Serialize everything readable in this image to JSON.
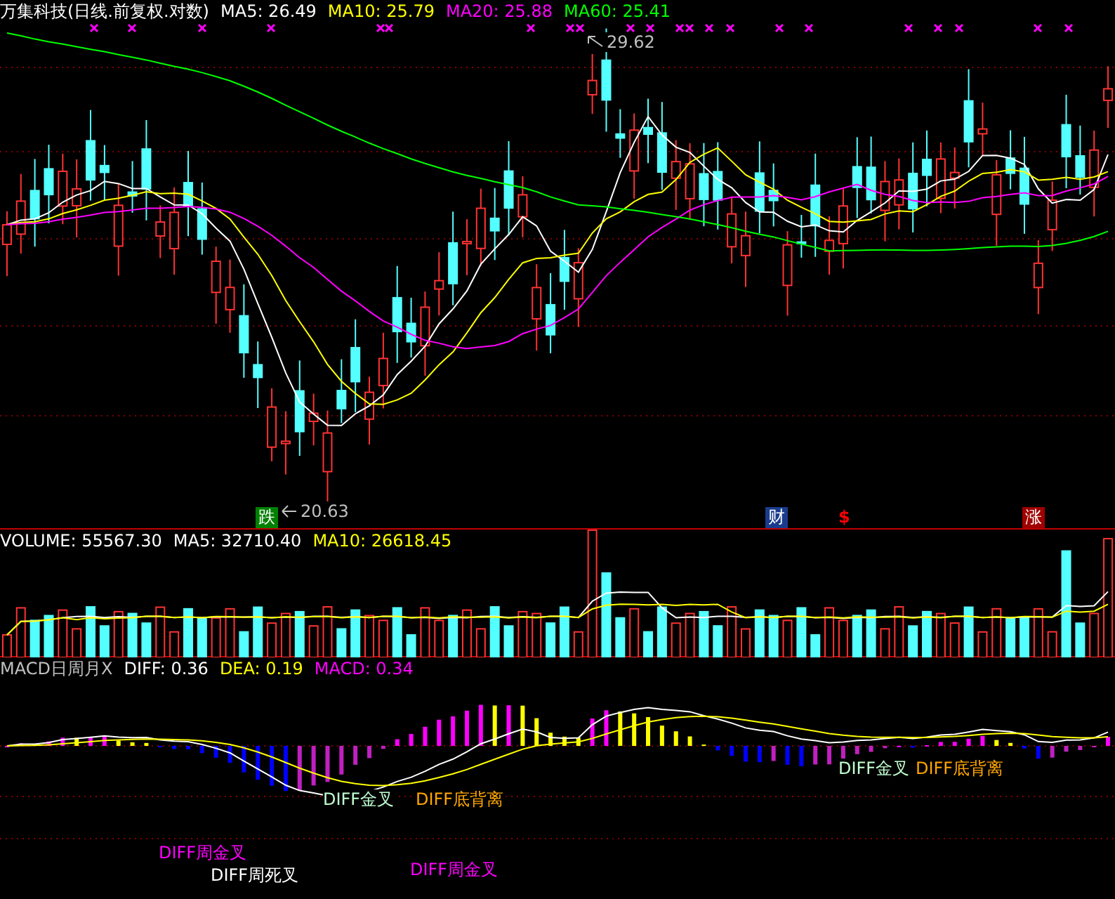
{
  "price_panel": {
    "title": "万集科技(日线.前复权.对数)",
    "ma_readings": [
      {
        "text": "MA5: 26.49",
        "color": "#ffffff"
      },
      {
        "text": "MA10: 25.79",
        "color": "#ffff00"
      },
      {
        "text": "MA20: 25.88",
        "color": "#ff00ff"
      },
      {
        "text": "MA60: 25.41",
        "color": "#00ff00"
      }
    ],
    "high_label": "29.62",
    "low_label": "20.63",
    "markers": [
      {
        "text": "跌",
        "kind": "badge",
        "color": "#008000"
      },
      {
        "text": "财",
        "kind": "badge",
        "color": "#1a3c8c"
      },
      {
        "text": "$",
        "kind": "glyph",
        "color": "#ff0000"
      },
      {
        "text": "涨",
        "kind": "badge",
        "color": "#a00000"
      }
    ]
  },
  "volume_panel": {
    "readings": [
      {
        "text": "VOLUME: 55567.30",
        "color": "#ffffff"
      },
      {
        "text": "MA5: 32710.40",
        "color": "#ffffff"
      },
      {
        "text": "MA10: 26618.45",
        "color": "#ffff00"
      }
    ]
  },
  "macd_panel": {
    "readings": [
      {
        "text": "MACD日周月X",
        "color": "#c0c0c0"
      },
      {
        "text": "DIFF: 0.36",
        "color": "#ffffff"
      },
      {
        "text": "DEA: 0.19",
        "color": "#ffff00"
      },
      {
        "text": "MACD: 0.34",
        "color": "#ff00ff"
      }
    ],
    "signals": [
      {
        "text": "DIFF金叉",
        "color": "#c0ffd0"
      },
      {
        "text": "DIFF底背离",
        "color": "#ffa500"
      },
      {
        "text": "DIFF金叉",
        "color": "#c0ffd0"
      },
      {
        "text": "DIFF底背离",
        "color": "#ffa500"
      },
      {
        "text": "DIFF周金叉",
        "color": "#ff00ff"
      },
      {
        "text": "DIFF周死叉",
        "color": "#ffffff"
      },
      {
        "text": "DIFF周金叉",
        "color": "#ff00ff"
      }
    ]
  }
}
